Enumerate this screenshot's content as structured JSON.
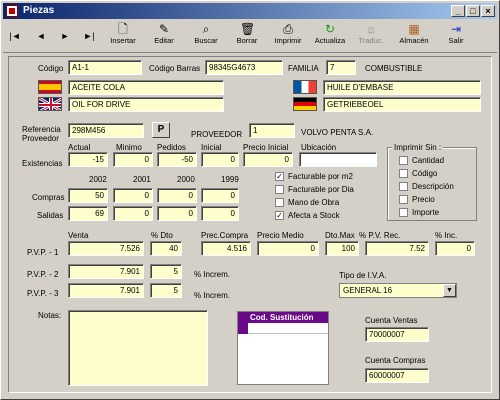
{
  "window": {
    "title": "Piezas"
  },
  "toolbar": {
    "insertar": "Insertar",
    "editar": "Editar",
    "buscar": "Buscar",
    "borrar": "Borrar",
    "imprimir": "Imprimir",
    "actualiza": "Actualiza",
    "traduc": "Traduc.",
    "almacen": "Almacén",
    "salir": "Salir"
  },
  "labels": {
    "codigo": "Código",
    "codigo_barras": "Código Barras",
    "familia": "FAMILIA",
    "familia_name": "COMBUSTIBLE",
    "referencia": "Referencia",
    "proveedor_ref": "Proveedor",
    "proveedor": "PROVEEDOR",
    "existencias": "Existencias",
    "compras": "Compras",
    "salidas": "Salidas",
    "actual": "Actual",
    "minimo": "Minimo",
    "pedidos": "Pedidos",
    "inicial": "Inicial",
    "precio_inicial": "Precio Inicial",
    "ubicacion": "Ubicación",
    "y2002": "2002",
    "y2001": "2001",
    "y2000": "2000",
    "y1999": "1999",
    "venta": "Venta",
    "dto": "% Dto",
    "prec_compra": "Prec.Compra",
    "precio_medio": "Precio Medio",
    "dto_max": "Dto.Max",
    "pvp_rec": "% P.V. Rec.",
    "inc": "% Inc.",
    "pvp1": "P.V.P. - 1",
    "pvp2": "P.V.P. - 2",
    "pvp3": "P.V.P. - 3",
    "increm": "% Increm.",
    "tipo_iva": "Tipo de I.V.A.",
    "notas": "Notas:",
    "cuenta_ventas": "Cuenta Ventas",
    "cuenta_compras": "Cuenta Compras",
    "imprimir_sin": "Imprimir Sin :",
    "p_button": "P"
  },
  "fields": {
    "codigo": "A1-1",
    "codigo_barras": "98345G4673",
    "familia": "7",
    "desc_es": "ACEITE COLA",
    "desc_en": "OIL FOR DRIVE",
    "desc_fr": "HUILE D'EMBASE",
    "desc_de": "GETRIEBEOEL",
    "referencia": "298M456",
    "proveedor_code": "1",
    "proveedor_name": "VOLVO PENTA S.A.",
    "existencias": [
      "-15",
      "0",
      "-50",
      "0",
      "0",
      ""
    ],
    "compras": [
      "50",
      "0",
      "0",
      "0"
    ],
    "salidas": [
      "69",
      "0",
      "0",
      "0"
    ],
    "pvp1": {
      "venta": "7.526",
      "dto": "40",
      "prec_compra": "4.516",
      "precio_medio": "0",
      "dto_max": "100",
      "pvp_rec": "7.52",
      "inc": "0"
    },
    "pvp2": {
      "venta": "7.901",
      "dto": "5"
    },
    "pvp3": {
      "venta": "7.901",
      "dto": "5"
    },
    "tipo_iva": "GENERAL 16",
    "cuenta_ventas": "70000007",
    "cuenta_compras": "60000007"
  },
  "checks": {
    "facturable_m2": "Facturable por m2",
    "facturable_dia": "Facturable por Dia",
    "mano_obra": "Mano de Obra",
    "afecta_stock": "Afecta a Stock",
    "facturable_m2_checked": true,
    "afecta_stock_checked": true
  },
  "imprimir_sin": {
    "cantidad": "Cantidad",
    "codigo": "Código",
    "descripcion": "Descripción",
    "precio": "Precio",
    "importe": "Importe"
  },
  "sustitucion": {
    "header": "Cod. Sustitución"
  }
}
